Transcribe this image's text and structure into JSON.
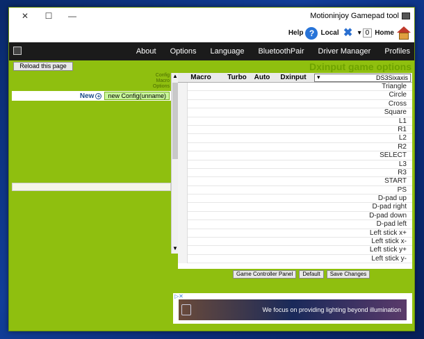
{
  "window": {
    "title": "Motioninjoy Gamepad tool",
    "controls": [
      "✕",
      "☐",
      "—"
    ]
  },
  "toolbar": {
    "help": "Help",
    "local": "Local",
    "home": "Home",
    "stepper_value": "0",
    "stepper_arrow": "▾"
  },
  "menu": {
    "items": [
      "About",
      "Options",
      "Language",
      "BluetoothPair",
      "Driver Manager",
      "Profiles"
    ]
  },
  "content": {
    "reload_label": "Reload this page",
    "section_title": "Dxinput game options",
    "side_links": [
      "Config",
      "Macro",
      "Options"
    ],
    "config_name": "new Config(unname)",
    "new_label": "New",
    "table": {
      "headers": {
        "macro": "Macro",
        "turbo": "Turbo",
        "auto": "Auto",
        "dxinput": "Dxinput"
      },
      "select_value": "DS3Sixaxis",
      "rows": [
        "Triangle",
        "Circle",
        "Cross",
        "Square",
        "L1",
        "R1",
        "L2",
        "R2",
        "SELECT",
        "L3",
        "R3",
        "START",
        "PS",
        "D-pad up",
        "D-pad right",
        "D-pad down",
        "D-pad left",
        "Left stick x+",
        "Left stick x-",
        "Left stick y+",
        "Left stick y-"
      ]
    },
    "buttons": {
      "controller_panel": "Game Controller Panel",
      "default": "Default",
      "save": "Save Changes"
    },
    "ad": {
      "text": "We focus on providing lighting beyond illumination"
    }
  },
  "colors": {
    "panel_green": "#8fbf0f",
    "menubar": "#1b1b1b",
    "title_green": "#6ea300"
  }
}
